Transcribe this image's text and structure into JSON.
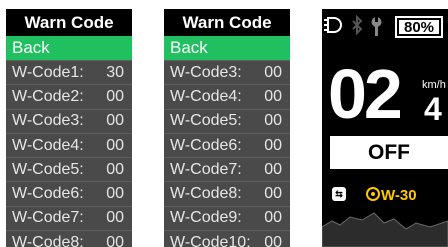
{
  "screen1": {
    "header": "Warn Code",
    "back_label": "Back",
    "rows": [
      {
        "label": "W-Code1:",
        "value": "30"
      },
      {
        "label": "W-Code2:",
        "value": "00"
      },
      {
        "label": "W-Code3:",
        "value": "00"
      },
      {
        "label": "W-Code4:",
        "value": "00"
      },
      {
        "label": "W-Code5:",
        "value": "00"
      },
      {
        "label": "W-Code6:",
        "value": "00"
      },
      {
        "label": "W-Code7:",
        "value": "00"
      },
      {
        "label": "W-Code8:",
        "value": "00"
      }
    ]
  },
  "screen2": {
    "header": "Warn Code",
    "back_label": "Back",
    "rows": [
      {
        "label": "W-Code3:",
        "value": "00"
      },
      {
        "label": "W-Code4:",
        "value": "00"
      },
      {
        "label": "W-Code5:",
        "value": "00"
      },
      {
        "label": "W-Code6:",
        "value": "00"
      },
      {
        "label": "W-Code7:",
        "value": "00"
      },
      {
        "label": "W-Code8:",
        "value": "00"
      },
      {
        "label": "W-Code9:",
        "value": "00"
      },
      {
        "label": "W-Code10:",
        "value": "00"
      }
    ]
  },
  "dashboard": {
    "battery": "80%",
    "speed": "02",
    "speed_decimal": "4",
    "unit": "km/h",
    "assist": "OFF",
    "warn_level": "W-30",
    "icons": [
      "headlight-icon",
      "bluetooth-icon",
      "wrench-icon",
      "battery-icon",
      "walk-icon",
      "gear-icon"
    ]
  },
  "colors": {
    "green": "#20c060",
    "yellow": "#ffc800",
    "row_bg": "#4a4a4a"
  }
}
